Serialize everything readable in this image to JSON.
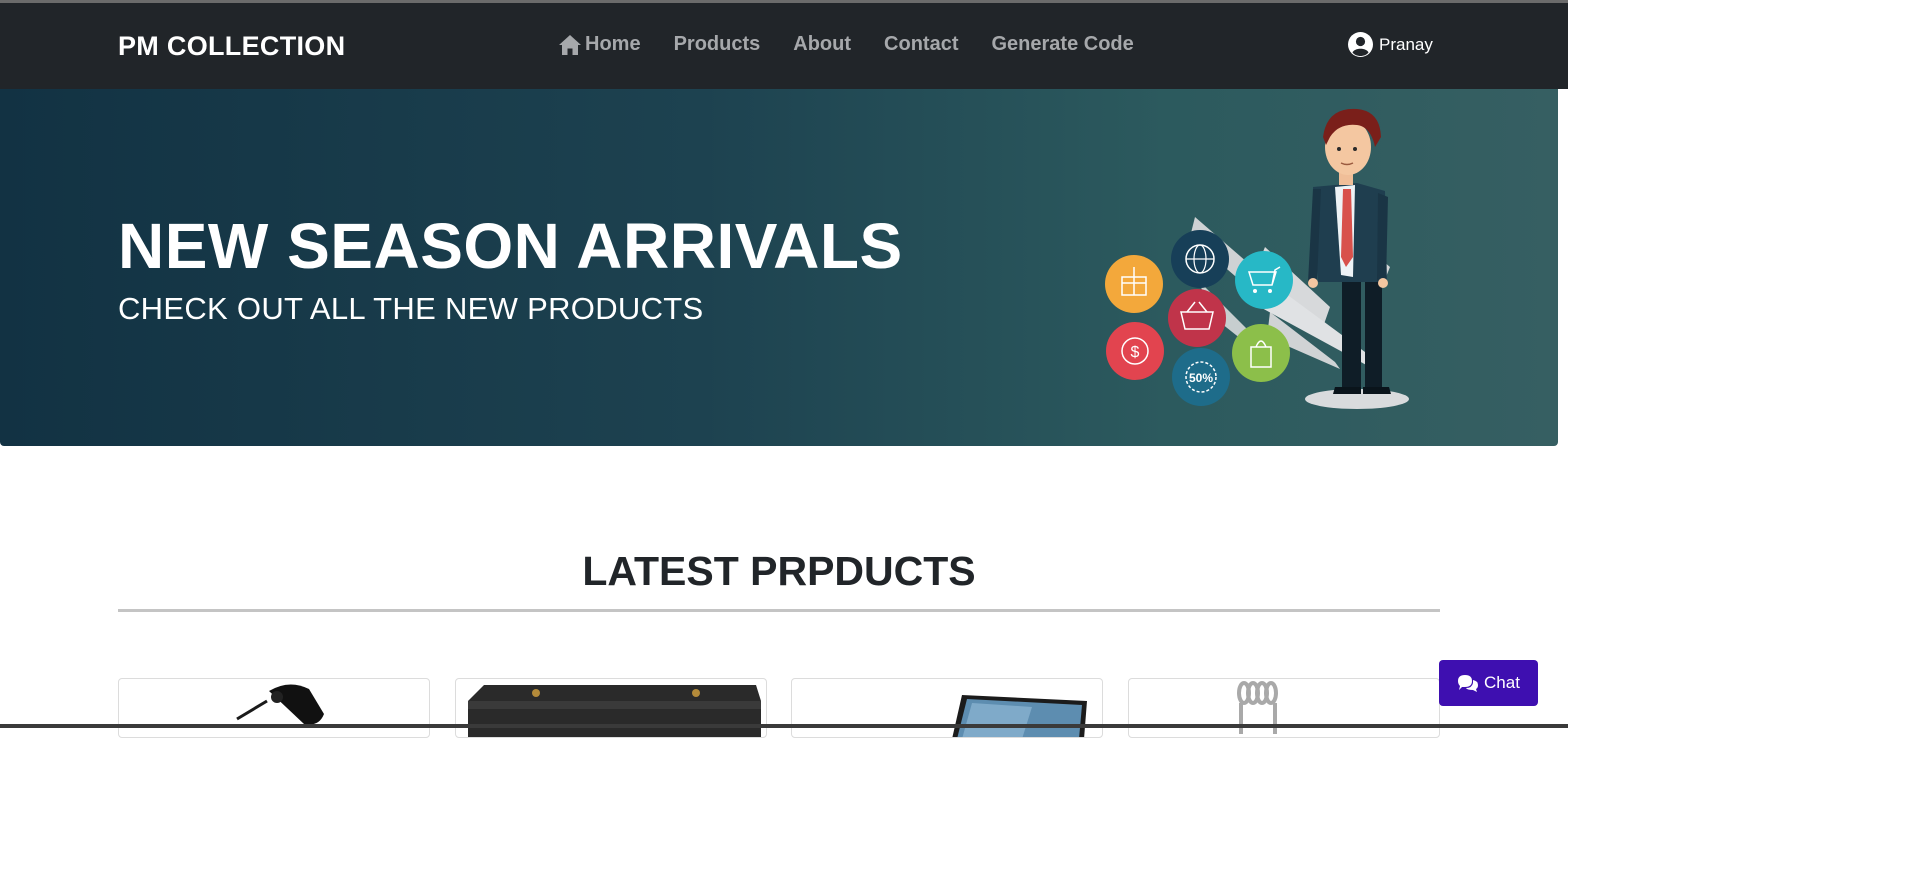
{
  "brand": "PM COLLECTION",
  "nav": {
    "items": [
      {
        "label": "Home",
        "icon": "home-icon"
      },
      {
        "label": "Products"
      },
      {
        "label": "About"
      },
      {
        "label": "Contact"
      },
      {
        "label": "Generate Code"
      }
    ]
  },
  "user": {
    "name": "Pranay",
    "icon": "user-circle-icon"
  },
  "hero": {
    "title": "NEW SEASON ARRIVALS",
    "subtitle": "CHECK OUT ALL THE NEW PRODUCTS",
    "badge_text": "50%"
  },
  "section": {
    "title": "LATEST PRPDUCTS"
  },
  "chat": {
    "label": "Chat",
    "icon": "chat-icon"
  },
  "colors": {
    "navbar": "#212529",
    "hero_start": "#123243",
    "hero_end": "#365f62",
    "chat": "#3e0fb0"
  }
}
